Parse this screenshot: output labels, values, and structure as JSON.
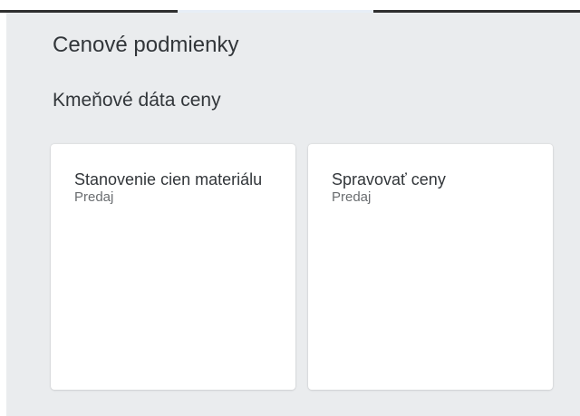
{
  "header": {
    "group_title": "Cenové podmienky",
    "section_title": "Kmeňové dáta ceny"
  },
  "tiles": [
    {
      "title": "Stanovenie cien materiálu",
      "subtitle": "Predaj"
    },
    {
      "title": "Spravovať ceny",
      "subtitle": "Predaj"
    }
  ]
}
